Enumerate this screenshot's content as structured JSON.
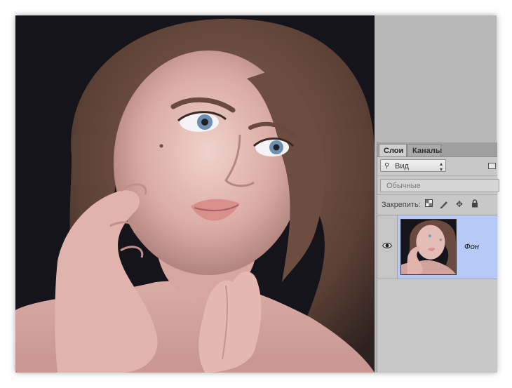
{
  "panel": {
    "tabs": [
      {
        "label": "Слои",
        "active": true
      },
      {
        "label": "Каналы",
        "active": false
      }
    ],
    "filter": {
      "label": "Вид"
    },
    "blend_mode": {
      "value": "Обычные"
    },
    "lock": {
      "label": "Закрепить:"
    },
    "layers": [
      {
        "name": "Фон",
        "visible": true,
        "selected": true
      }
    ]
  },
  "colors": {
    "selected_layer": "#b6c9f7",
    "panel_bg": "#c8c8c8",
    "workspace_bg": "#b8b8b8"
  },
  "icons": [
    "search-icon",
    "up-down-arrows-icon",
    "image-filter-icon",
    "lock-transparent-pixels-icon",
    "lock-image-pixels-icon",
    "lock-position-icon",
    "lock-all-icon",
    "eye-icon"
  ]
}
